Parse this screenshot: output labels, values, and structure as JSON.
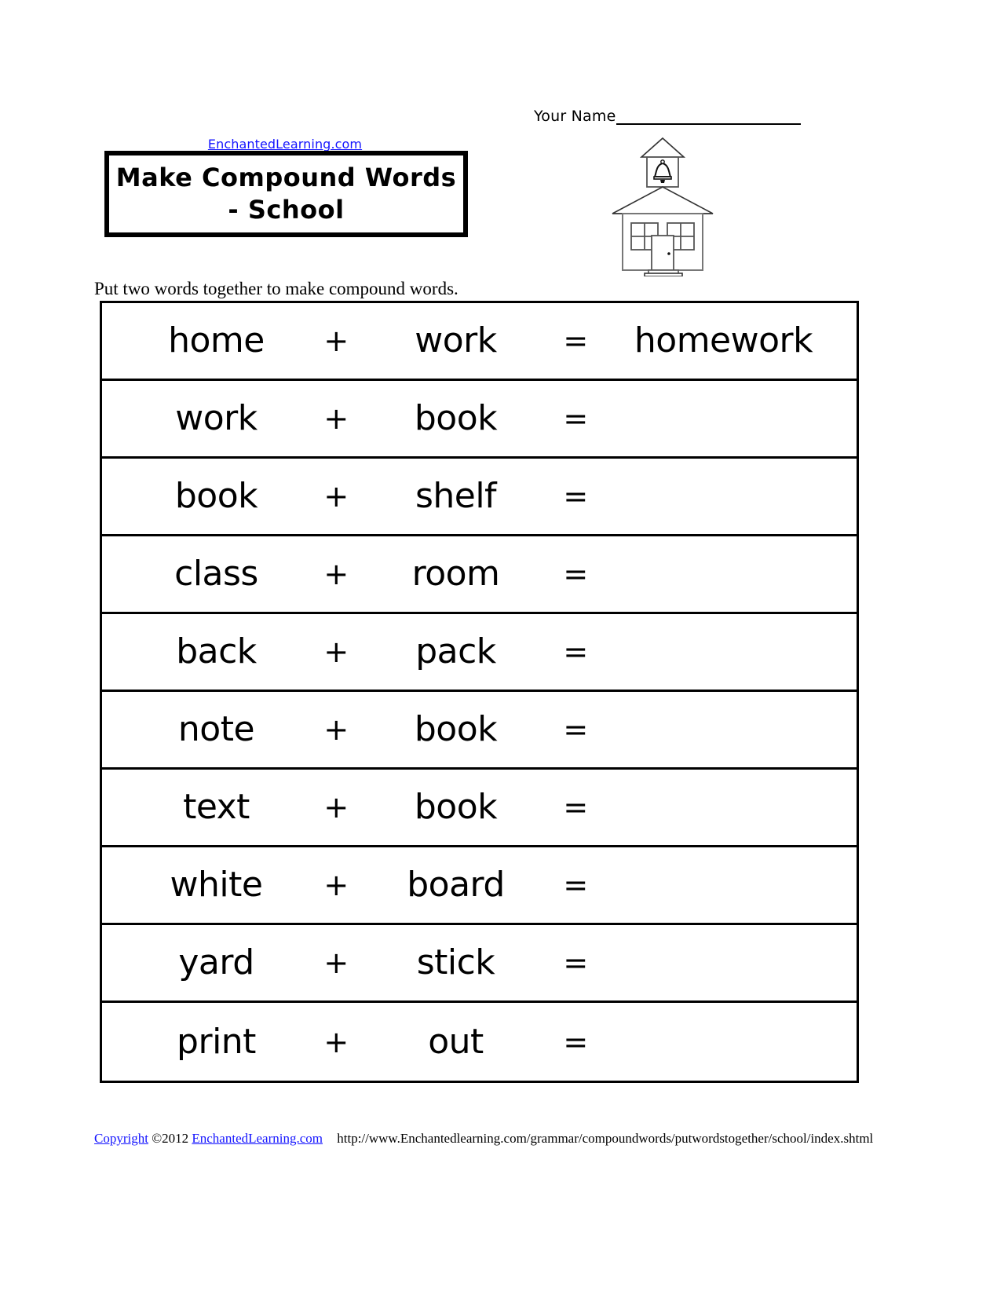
{
  "name_field": {
    "label": "Your Name",
    "value": ""
  },
  "brand": {
    "link_text": "EnchantedLearning.com",
    "link_color": "#1414ff"
  },
  "title": {
    "text": "Make Compound Words - School"
  },
  "illustration": {
    "name": "schoolhouse-illustration",
    "alt": "one-room schoolhouse with bell tower"
  },
  "instructions": {
    "text": "Put two words together to make compound words."
  },
  "table": {
    "plus_symbol": "+",
    "equals_symbol": "=",
    "rows": [
      {
        "word1": "home",
        "word2": "work",
        "answer": "homework"
      },
      {
        "word1": "work",
        "word2": "book",
        "answer": ""
      },
      {
        "word1": "book",
        "word2": "shelf",
        "answer": ""
      },
      {
        "word1": "class",
        "word2": "room",
        "answer": ""
      },
      {
        "word1": "back",
        "word2": "pack",
        "answer": ""
      },
      {
        "word1": "note",
        "word2": "book",
        "answer": ""
      },
      {
        "word1": "text",
        "word2": "book",
        "answer": ""
      },
      {
        "word1": "white",
        "word2": "board",
        "answer": ""
      },
      {
        "word1": "yard",
        "word2": "stick",
        "answer": ""
      },
      {
        "word1": "print",
        "word2": "out",
        "answer": ""
      }
    ]
  },
  "footer": {
    "copyright_link": "Copyright",
    "copyright_year": "©2012",
    "site_link": "EnchantedLearning.com",
    "url": "http://www.Enchantedlearning.com/grammar/compoundwords/putwordstogether/school/index.shtml"
  }
}
